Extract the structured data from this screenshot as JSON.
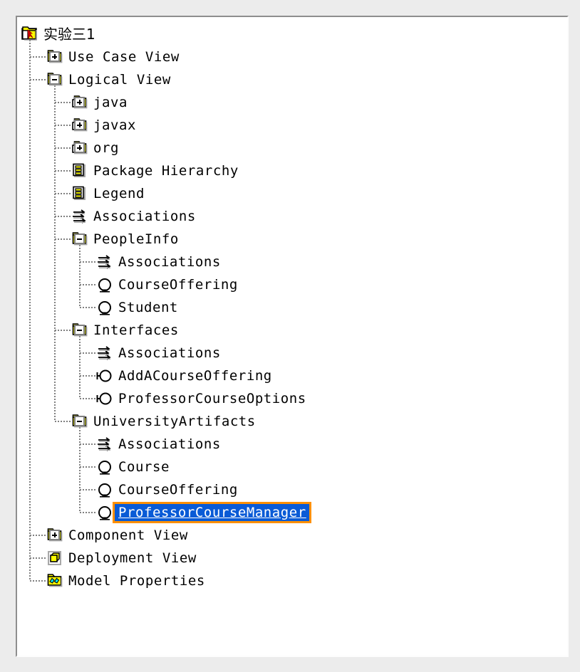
{
  "window": {
    "title": "实验三1",
    "panel_type": "model-browser-tree"
  },
  "colors": {
    "selection_background": "#0a5bd6",
    "selection_text": "#ffffff",
    "focus_border": "#ff9000",
    "folder_yellow": "#ffff00",
    "guide_line": "#808080",
    "panel_background": "#ffffff",
    "app_background": "#ececec"
  },
  "tree": {
    "nodes": [
      {
        "id": "root",
        "label": "实验三1",
        "icon": "model-root-icon",
        "depth": 0,
        "toggle": "none",
        "selected": false,
        "cjk": true
      },
      {
        "id": "use-case-view",
        "label": "Use Case View",
        "icon": "folder-icon",
        "depth": 1,
        "toggle": "plus",
        "selected": false,
        "cjk": false
      },
      {
        "id": "logical-view",
        "label": "Logical View",
        "icon": "folder-icon",
        "depth": 1,
        "toggle": "minus",
        "selected": false,
        "cjk": false
      },
      {
        "id": "java",
        "label": "java",
        "icon": "package-icon",
        "depth": 2,
        "toggle": "plus",
        "selected": false,
        "cjk": false
      },
      {
        "id": "javax",
        "label": "javax",
        "icon": "package-icon",
        "depth": 2,
        "toggle": "plus",
        "selected": false,
        "cjk": false
      },
      {
        "id": "org",
        "label": "org",
        "icon": "package-icon",
        "depth": 2,
        "toggle": "plus",
        "selected": false,
        "cjk": false
      },
      {
        "id": "package-hierarchy",
        "label": "Package Hierarchy",
        "icon": "diagram-icon",
        "depth": 2,
        "toggle": "none",
        "selected": false,
        "cjk": false
      },
      {
        "id": "legend",
        "label": "Legend",
        "icon": "diagram-icon",
        "depth": 2,
        "toggle": "none",
        "selected": false,
        "cjk": false
      },
      {
        "id": "associations-logical",
        "label": "Associations",
        "icon": "associations-icon",
        "depth": 2,
        "toggle": "none",
        "selected": false,
        "cjk": false
      },
      {
        "id": "peopleinfo",
        "label": "PeopleInfo",
        "icon": "folder-icon",
        "depth": 2,
        "toggle": "minus",
        "selected": false,
        "cjk": false
      },
      {
        "id": "associations-people",
        "label": "Associations",
        "icon": "associations-icon",
        "depth": 3,
        "toggle": "none",
        "selected": false,
        "cjk": false
      },
      {
        "id": "courseoffering-people",
        "label": "CourseOffering",
        "icon": "class-icon",
        "depth": 3,
        "toggle": "none",
        "selected": false,
        "cjk": false
      },
      {
        "id": "student",
        "label": "Student",
        "icon": "class-icon",
        "depth": 3,
        "toggle": "none",
        "selected": false,
        "cjk": false
      },
      {
        "id": "interfaces",
        "label": "Interfaces",
        "icon": "folder-icon",
        "depth": 2,
        "toggle": "minus",
        "selected": false,
        "cjk": false
      },
      {
        "id": "associations-iface",
        "label": "Associations",
        "icon": "associations-icon",
        "depth": 3,
        "toggle": "none",
        "selected": false,
        "cjk": false
      },
      {
        "id": "addacourseoffering",
        "label": "AddACourseOffering",
        "icon": "interface-icon",
        "depth": 3,
        "toggle": "none",
        "selected": false,
        "cjk": false
      },
      {
        "id": "professorcourseoptions",
        "label": "ProfessorCourseOptions",
        "icon": "interface-icon",
        "depth": 3,
        "toggle": "none",
        "selected": false,
        "cjk": false
      },
      {
        "id": "universityartifacts",
        "label": "UniversityArtifacts",
        "icon": "folder-icon",
        "depth": 2,
        "toggle": "minus",
        "selected": false,
        "cjk": false
      },
      {
        "id": "associations-univ",
        "label": "Associations",
        "icon": "associations-icon",
        "depth": 3,
        "toggle": "none",
        "selected": false,
        "cjk": false
      },
      {
        "id": "course",
        "label": "Course",
        "icon": "class-icon",
        "depth": 3,
        "toggle": "none",
        "selected": false,
        "cjk": false
      },
      {
        "id": "courseoffering-univ",
        "label": "CourseOffering",
        "icon": "class-icon",
        "depth": 3,
        "toggle": "none",
        "selected": false,
        "cjk": false
      },
      {
        "id": "professorcoursemanager",
        "label": "ProfessorCourseManager",
        "icon": "class-icon",
        "depth": 3,
        "toggle": "none",
        "selected": true,
        "cjk": false
      },
      {
        "id": "component-view",
        "label": "Component View",
        "icon": "folder-icon",
        "depth": 1,
        "toggle": "plus",
        "selected": false,
        "cjk": false
      },
      {
        "id": "deployment-view",
        "label": "Deployment View",
        "icon": "deployment-icon",
        "depth": 1,
        "toggle": "none",
        "selected": false,
        "cjk": false
      },
      {
        "id": "model-properties",
        "label": "Model Properties",
        "icon": "properties-icon",
        "depth": 1,
        "toggle": "none",
        "selected": false,
        "cjk": false
      }
    ]
  }
}
